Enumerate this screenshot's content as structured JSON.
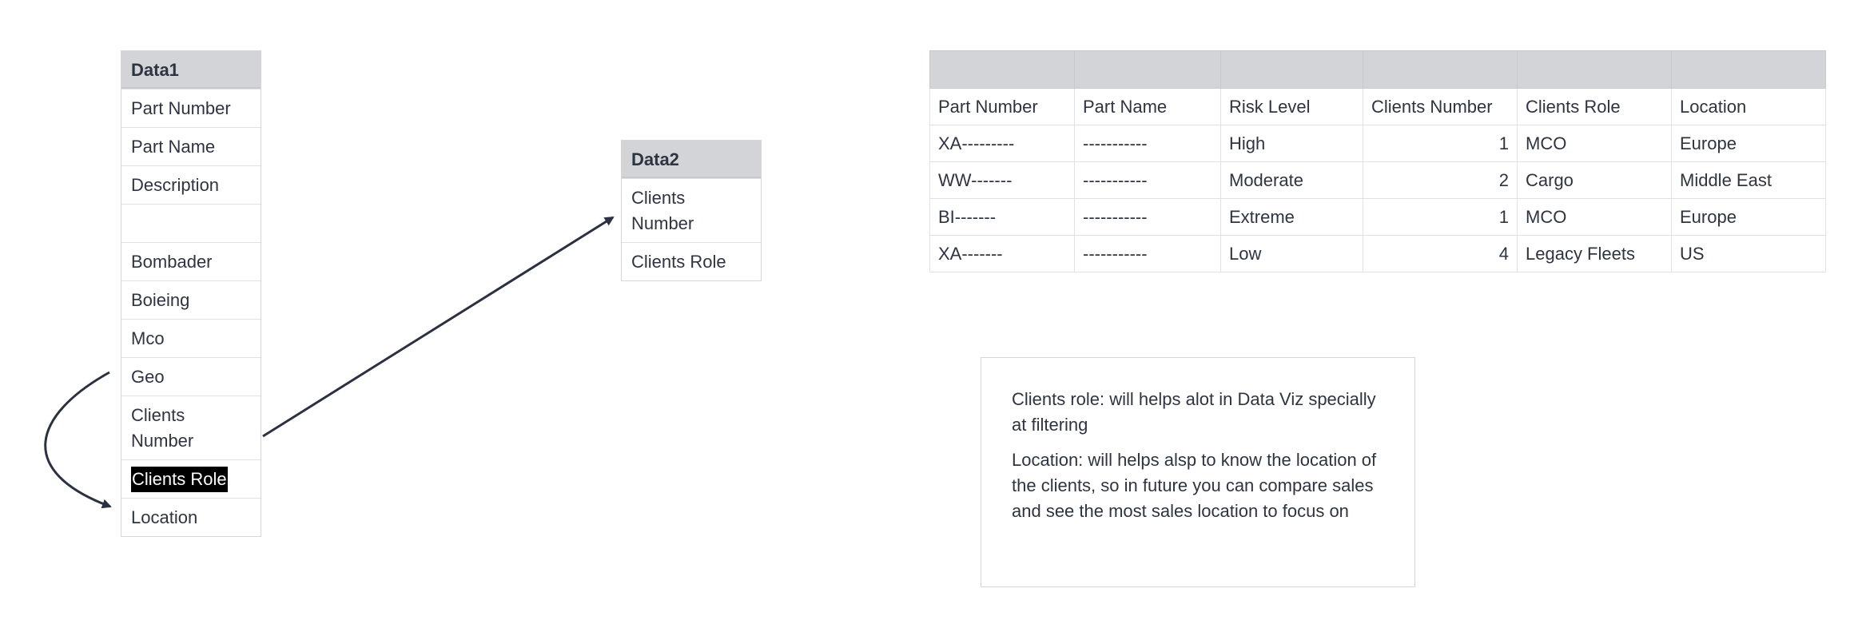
{
  "data1": {
    "title": "Data1",
    "fields": [
      "Part Number",
      "Part Name",
      "Description",
      "",
      "Bombader",
      "Boieing",
      "Mco",
      "Geo",
      "Clients Number",
      "Clients Role",
      "Location"
    ]
  },
  "data2": {
    "title": "Data2",
    "fields": [
      "Clients Number",
      "Clients Role"
    ]
  },
  "table": {
    "columns": [
      "Part Number",
      "Part Name",
      "Risk Level",
      "Clients Number",
      "Clients Role",
      "Location"
    ],
    "rows": [
      [
        "XA---------",
        "-----------",
        "High",
        "1",
        "MCO",
        "Europe"
      ],
      [
        "WW-------",
        "-----------",
        "Moderate",
        "2",
        "Cargo",
        "Middle East"
      ],
      [
        "BI-------",
        "-----------",
        "Extreme",
        "1",
        "MCO",
        "Europe"
      ],
      [
        "XA-------",
        "-----------",
        "Low",
        "4",
        "Legacy Fleets",
        "US"
      ]
    ]
  },
  "note": {
    "p1": "Clients role: will helps alot in Data Viz specially at filtering",
    "p2": "Location: will helps alsp to know the location of the clients, so in future you can compare sales and see the most sales location to focus on"
  },
  "colors": {
    "header": "#d3d4d8",
    "border": "#dfe1e5",
    "text": "#2e3440",
    "arrow": "#2b3140"
  }
}
